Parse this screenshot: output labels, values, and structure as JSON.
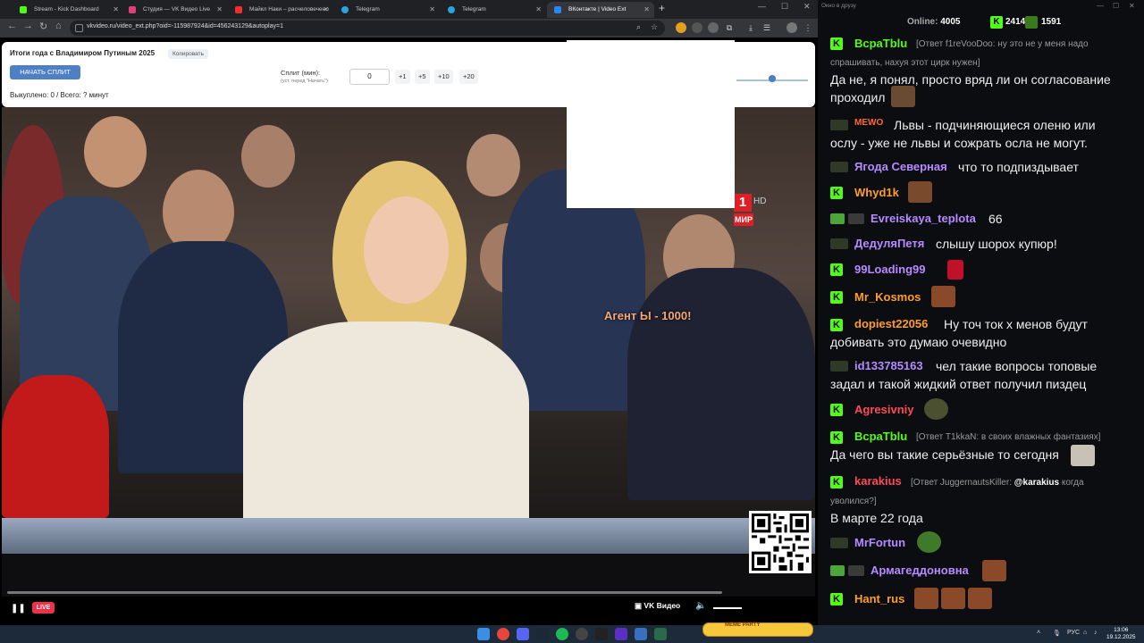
{
  "browser": {
    "tabs": [
      {
        "label": "Stream - Kick Dashboard",
        "color": "#53fc18"
      },
      {
        "label": "Студия — VK Видео Live",
        "color": "#e0407a"
      },
      {
        "label": "Майкл Наки – расчелoвечено",
        "color": "#ff2a2a"
      },
      {
        "label": "Telegram",
        "color": "#2aa3e0"
      },
      {
        "label": "Telegram",
        "color": "#2aa3e0"
      },
      {
        "label": "ВКонтакте | Video Ext",
        "color": "#2787f5"
      }
    ],
    "url": "vkvideo.ru/video_ext.php?oid=-115987924&id=456243129&autoplay=1"
  },
  "panel": {
    "title": "Итоги года с Владимиром Путиным 2025",
    "copy_label": "Копировать",
    "start_split_label": "НАЧАТЬ СПЛИТ",
    "split_label": "Сплит (мин):",
    "split_hint": "(уст. перед \"Начать\")",
    "split_value": "0",
    "increments": [
      "+1",
      "+5",
      "+10",
      "+20"
    ],
    "stats": "Выкуплено: 0 / Всего: ? минут"
  },
  "video": {
    "overlay_text": "Агент Ы - 1000!",
    "channel_digit": "1",
    "channel_hd": "HD",
    "channel_name": "МИР",
    "live_label": "LIVE",
    "brand_label": "VK Видео"
  },
  "chat": {
    "title": "Окно в друзу",
    "online_label": "Online:",
    "online_count": "4005",
    "stat_a": "2414",
    "stat_b": "1591",
    "colors": {
      "kick_green": "#53fc18",
      "username_purple": "#b58bff",
      "username_orange": "#ff9d2a"
    },
    "messages": [
      {
        "user": "BcpaTblu",
        "reply": "[Ответ f1reVooDoo: ну это не у меня надо",
        "reply2": "спрашивать, нахуя этот цирк нужен]",
        "text": "Да не, я понял, просто вряд ли он согласование",
        "text2": "проходил"
      },
      {
        "user": "MEWO",
        "text": "Львы - подчиняющиеся оленю или",
        "text2": "ослу - уже не львы и сожрать осла не могут."
      },
      {
        "user": "Ягода Северная",
        "text": "что то подпиздывает"
      },
      {
        "user": "Whyd1k",
        "text": ""
      },
      {
        "user": "Evreiskaya_teplota",
        "text": "66"
      },
      {
        "user": "ДедуляПетя",
        "text": "слышу шорох купюр!"
      },
      {
        "user": "99Loading99",
        "text": ""
      },
      {
        "user": "Mr_Kosmos",
        "text": ""
      },
      {
        "user": "dopiest22056",
        "text": "Ну точ ток х менов будут",
        "text2": "добивать это думаю очевидно"
      },
      {
        "user": "id133785163",
        "text": "чел такие вопросы топовые",
        "text2": "задал и такой жидкий ответ получил пиздец"
      },
      {
        "user": "Agresivniy",
        "text": ""
      },
      {
        "user": "BcpaTblu",
        "reply": "[Ответ T1kkaN: в своих влажных фантазиях]",
        "text": "Да чего вы такие серьёзные то сегодня"
      },
      {
        "user": "karakius",
        "reply_pre": "[Ответ JuggernautsKiller: ",
        "mention": "@karakius",
        "reply_post": " когда",
        "reply2": "уволился?]",
        "text": "В марте 22 года"
      },
      {
        "user": "MrFortun",
        "text": ""
      },
      {
        "user": "Армагеддоновна",
        "text": ""
      },
      {
        "user": "Hant_rus",
        "text": ""
      }
    ]
  },
  "taskbar": {
    "meme_label": "MEME PARTY",
    "lang": "РУС",
    "time": "13:06",
    "date": "19.12.2025"
  }
}
